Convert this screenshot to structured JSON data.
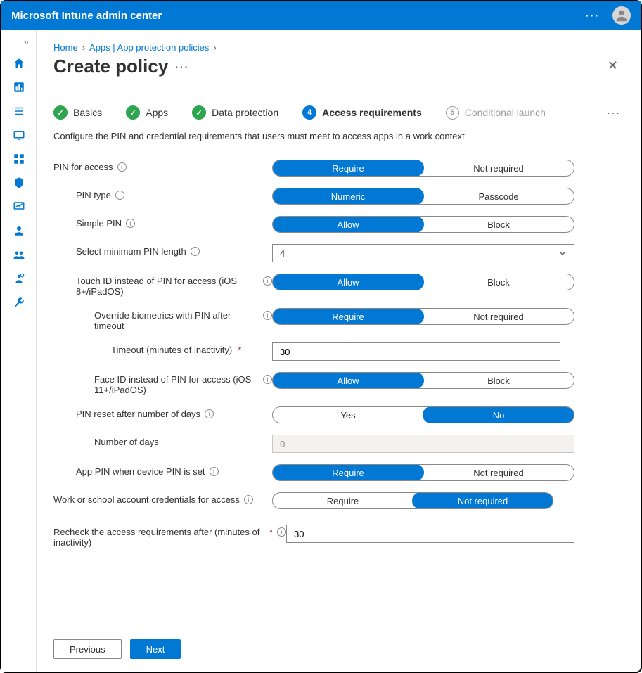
{
  "header": {
    "title": "Microsoft Intune admin center"
  },
  "breadcrumb": {
    "home": "Home",
    "apps": "Apps | App protection policies"
  },
  "page": {
    "title": "Create policy"
  },
  "steps": [
    {
      "label": "Basics",
      "state": "done"
    },
    {
      "label": "Apps",
      "state": "done"
    },
    {
      "label": "Data protection",
      "state": "done"
    },
    {
      "label": "Access requirements",
      "state": "active",
      "num": "4"
    },
    {
      "label": "Conditional launch",
      "state": "pending",
      "num": "5"
    }
  ],
  "description": "Configure the PIN and credential requirements that users must meet to access apps in a work context.",
  "fields": {
    "pin_for_access": {
      "label": "PIN for access",
      "opt1": "Require",
      "opt2": "Not required",
      "selected": 0
    },
    "pin_type": {
      "label": "PIN type",
      "opt1": "Numeric",
      "opt2": "Passcode",
      "selected": 0
    },
    "simple_pin": {
      "label": "Simple PIN",
      "opt1": "Allow",
      "opt2": "Block",
      "selected": 0
    },
    "min_pin_length": {
      "label": "Select minimum PIN length",
      "value": "4"
    },
    "touch_id": {
      "label": "Touch ID instead of PIN for access (iOS 8+/iPadOS)",
      "opt1": "Allow",
      "opt2": "Block",
      "selected": 0
    },
    "override_bio": {
      "label": "Override biometrics with PIN after timeout",
      "opt1": "Require",
      "opt2": "Not required",
      "selected": 0
    },
    "timeout": {
      "label": "Timeout (minutes of inactivity)",
      "value": "30"
    },
    "face_id": {
      "label": "Face ID instead of PIN for access (iOS 11+/iPadOS)",
      "opt1": "Allow",
      "opt2": "Block",
      "selected": 0
    },
    "pin_reset_days": {
      "label": "PIN reset after number of days",
      "opt1": "Yes",
      "opt2": "No",
      "selected": 1
    },
    "number_of_days": {
      "label": "Number of days",
      "value": "0"
    },
    "app_pin_when_device": {
      "label": "App PIN when device PIN is set",
      "opt1": "Require",
      "opt2": "Not required",
      "selected": 0
    },
    "work_creds": {
      "label": "Work or school account credentials for access",
      "opt1": "Require",
      "opt2": "Not required",
      "selected": 1
    },
    "recheck": {
      "label": "Recheck the access requirements after (minutes of inactivity)",
      "value": "30"
    }
  },
  "buttons": {
    "prev": "Previous",
    "next": "Next"
  }
}
